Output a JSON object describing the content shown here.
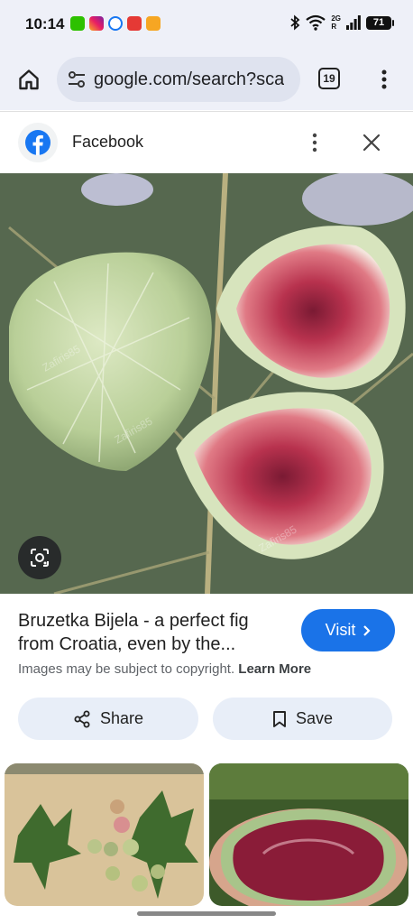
{
  "status_bar": {
    "time": "10:14",
    "battery": "71",
    "network": "2G",
    "roaming": "R",
    "notification_icons": [
      "wechat-icon",
      "instagram-icon",
      "messenger-icon",
      "app-icon",
      "app-icon-2"
    ]
  },
  "toolbar": {
    "url": "google.com/search?sca",
    "tab_count": "19"
  },
  "source": {
    "name": "Facebook"
  },
  "image": {
    "watermark": "Zafiris85"
  },
  "result": {
    "title": "Bruzetka Bijela - a perfect fig from Croatia, even by the...",
    "visit_label": "Visit",
    "copyright_text": "Images may be subject to copyright.",
    "learn_more_label": "Learn More"
  },
  "actions": {
    "share_label": "Share",
    "save_label": "Save"
  },
  "colors": {
    "accent": "#1a73e8",
    "facebook": "#1877f2",
    "toolbar_bg": "#eef0f8"
  }
}
